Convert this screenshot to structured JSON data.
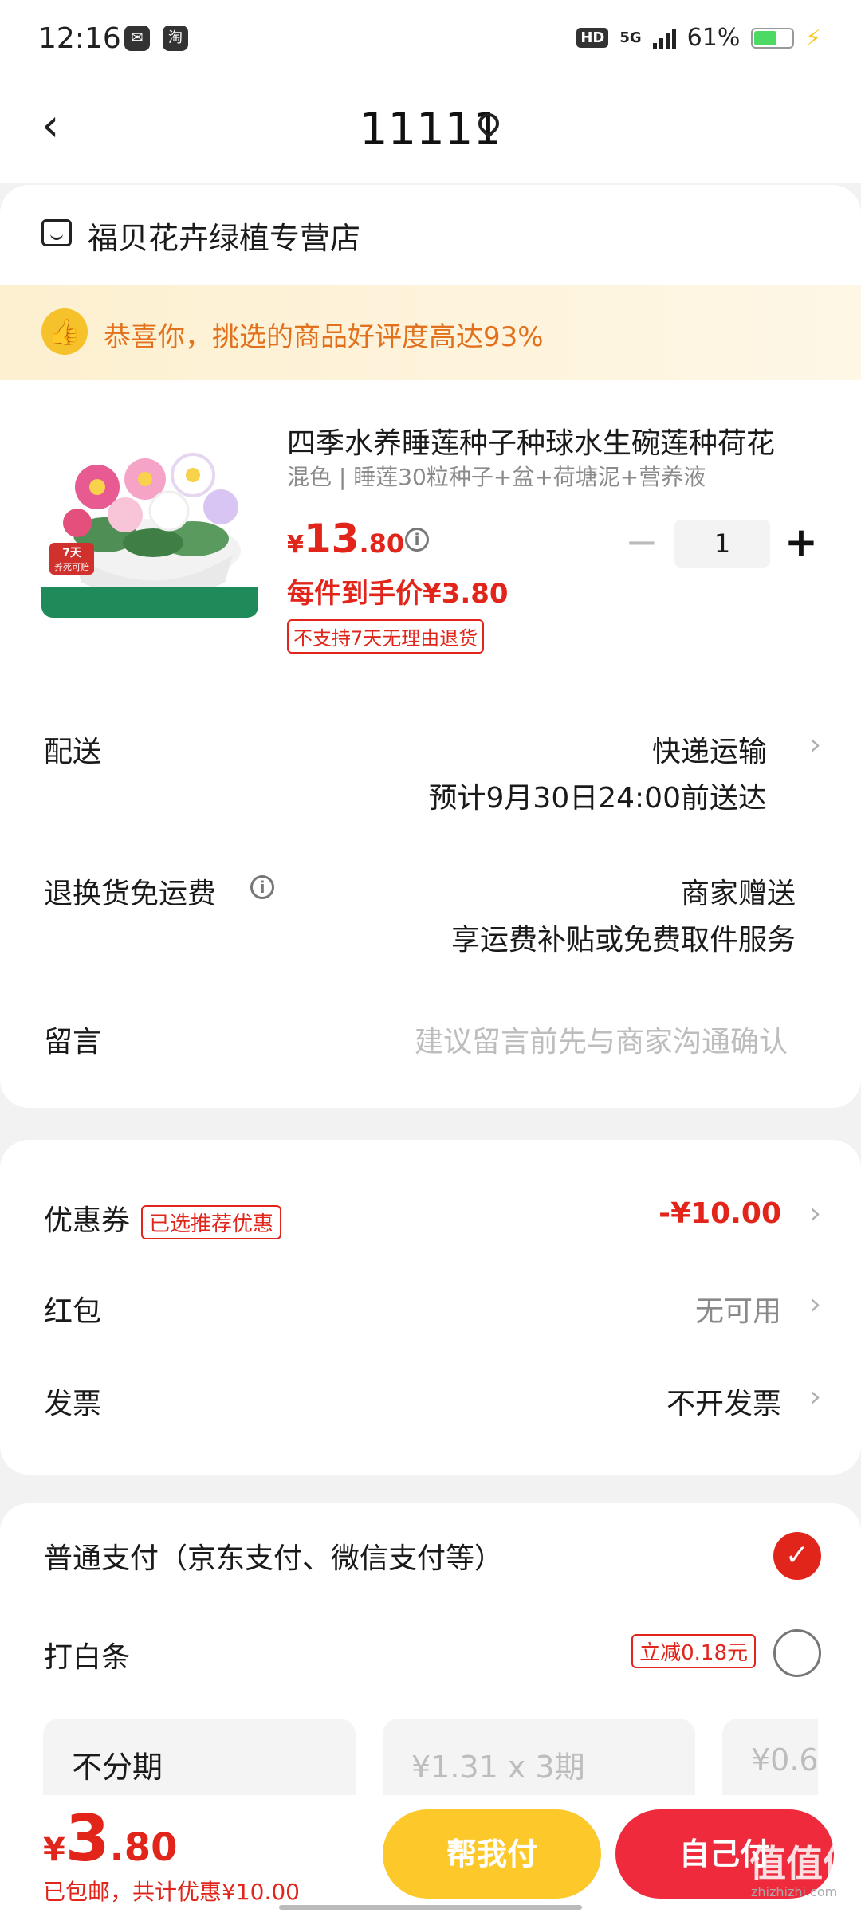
{
  "status_bar": {
    "time": "12:16",
    "app_icons": [
      "wechat-icon",
      "taobao-icon"
    ],
    "network": "5G",
    "hd": "HD",
    "battery": "61%",
    "battery_level": 0.61
  },
  "header": {
    "title": "11111"
  },
  "shop": {
    "name": "福贝花卉绿植专营店"
  },
  "banner": {
    "text": "恭喜你，挑选的商品好评度高达93%"
  },
  "product": {
    "title": "四季水养睡莲种子种球水生碗莲种荷花",
    "spec": "混色 | 睡莲30粒种子+盆+荷塘泥+营养液",
    "price_symbol": "¥",
    "price_int": "13",
    "price_dec": ".80",
    "quantity": "1",
    "per_item_price": "每件到手价¥3.80",
    "return_policy": "不支持7天无理由退货",
    "image_badge_top": "7天",
    "image_badge_bottom": "养死可赔"
  },
  "delivery": {
    "label": "配送",
    "method": "快递运输",
    "eta": "预计9月30日24:00前送达"
  },
  "return_shipping": {
    "label": "退换货免运费",
    "value": "商家赠送",
    "desc": "享运费补贴或免费取件服务"
  },
  "message": {
    "label": "留言",
    "placeholder": "建议留言前先与商家沟通确认"
  },
  "discounts": {
    "coupon_label": "优惠券",
    "coupon_tag": "已选推荐优惠",
    "coupon_value": "-¥10.00",
    "redpacket_label": "红包",
    "redpacket_value": "无可用",
    "invoice_label": "发票",
    "invoice_value": "不开发票"
  },
  "payment": {
    "normal_label": "普通支付（京东支付、微信支付等）",
    "baitiao_label": "打白条",
    "baitiao_tag": "立减0.18元",
    "plans": [
      "不分期",
      "¥1.31 x 3期",
      "¥0.6"
    ]
  },
  "bottom": {
    "total_symbol": "¥",
    "total_int": "3",
    "total_dec": ".80",
    "note": "已包邮，共计优惠¥10.00",
    "help_pay": "帮我付",
    "self_pay": "自己付",
    "watermark": "值值值",
    "watermark_sub": "zhizhizhi.com"
  },
  "colors": {
    "accent_red": "#e1251b",
    "yellow": "#fdc82a",
    "banner_text": "#e2711d"
  }
}
